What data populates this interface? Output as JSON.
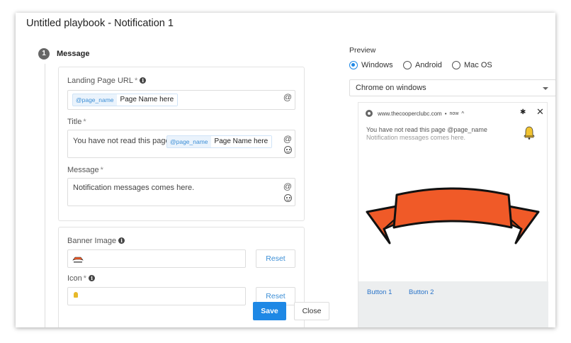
{
  "dialog": {
    "title": "Untitled playbook - Notification 1"
  },
  "step": {
    "number": "1",
    "title": "Message"
  },
  "form": {
    "landing_url": {
      "label": "Landing Page URL",
      "required_mark": "*",
      "tag": "@page_name",
      "value": "Page Name here"
    },
    "title_field": {
      "label": "Title",
      "required_mark": "*",
      "text": "You have not read this page",
      "tag": "@page_name",
      "value": "Page Name here"
    },
    "message_field": {
      "label": "Message",
      "required_mark": "*",
      "text": "Notification messages comes here."
    },
    "banner_image": {
      "label": "Banner Image",
      "reset_label": "Reset"
    },
    "icon_field": {
      "label": "Icon",
      "required_mark": "*",
      "reset_label": "Reset"
    },
    "at_symbol": "@"
  },
  "preview": {
    "label": "Preview",
    "platforms": [
      {
        "label": "Windows",
        "checked": true
      },
      {
        "label": "Android",
        "checked": false
      },
      {
        "label": "Mac OS",
        "checked": false
      }
    ],
    "browser_select": "Chrome on windows",
    "notification": {
      "site": "www.thecooperclubc.com",
      "time": "now",
      "title": "You have not read this page @page_name",
      "body": "Notification messages comes here.",
      "buttons": [
        "Button 1",
        "Button 2"
      ]
    }
  },
  "actions": {
    "save_label": "Save",
    "close_label": "Close"
  },
  "colors": {
    "accent": "#1e88e5",
    "banner": "#f05a28"
  }
}
